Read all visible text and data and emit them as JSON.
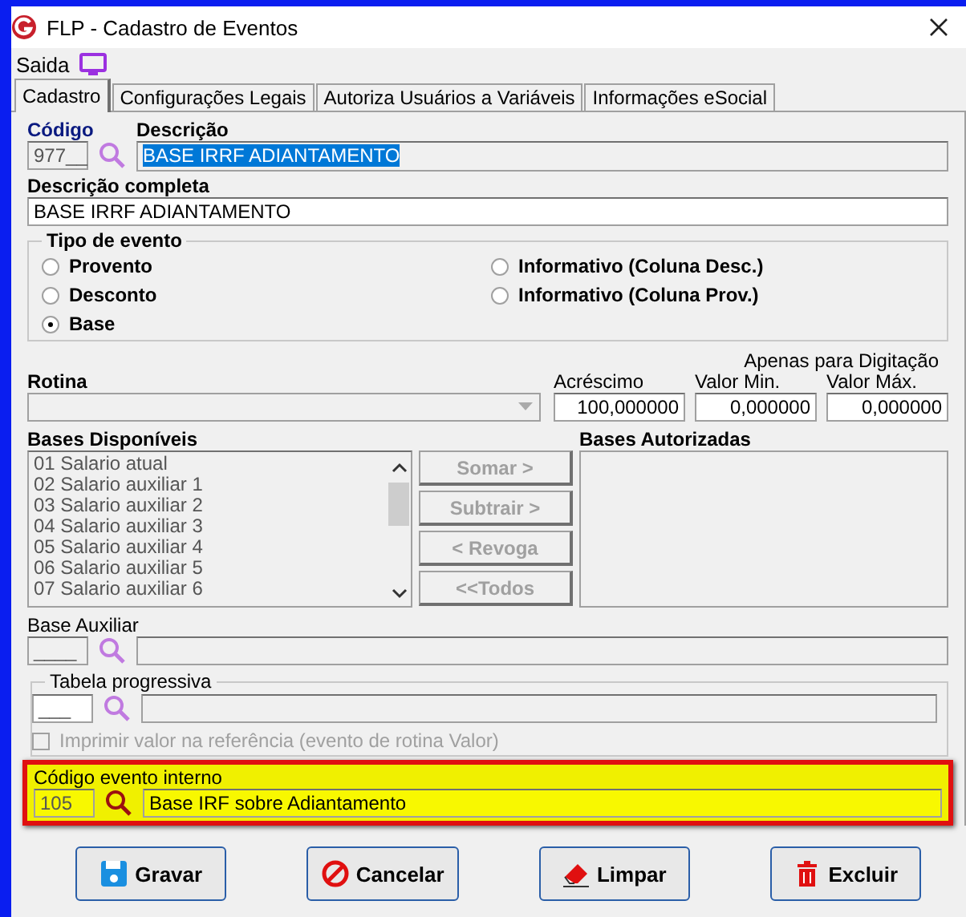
{
  "window": {
    "title": "FLP - Cadastro de Eventos"
  },
  "menu": [
    {
      "label": "Saida"
    }
  ],
  "tabs": [
    {
      "label": "Cadastro",
      "selected": true
    },
    {
      "label": "Configurações Legais",
      "selected": false
    },
    {
      "label": "Autoriza Usuários a Variáveis",
      "selected": false
    },
    {
      "label": "Informações eSocial",
      "selected": false
    }
  ],
  "codigo": {
    "label": "Código",
    "value": "977__"
  },
  "descricao": {
    "label": "Descrição",
    "value": "BASE IRRF ADIANTAMENTO",
    "highlighted": true
  },
  "descricao_completa": {
    "label": "Descrição completa",
    "value": "BASE IRRF ADIANTAMENTO"
  },
  "tipo_de_evento": {
    "title": "Tipo de evento",
    "options": [
      {
        "label": "Provento",
        "selected": false
      },
      {
        "label": "Desconto",
        "selected": false
      },
      {
        "label": "Base",
        "selected": true
      },
      {
        "label": "Informativo (Coluna Desc.)",
        "selected": false
      },
      {
        "label": "Informativo (Coluna Prov.)",
        "selected": false
      }
    ]
  },
  "rotina": {
    "label": "Rotina",
    "disabled": true
  },
  "apenas_para_digitacao": "Apenas para Digitação",
  "acrescimo": {
    "label": "Acréscimo",
    "value": "100,000000"
  },
  "valor_min": {
    "label": "Valor Min.",
    "value": "0,000000"
  },
  "valor_max": {
    "label": "Valor Máx.",
    "value": "0,000000"
  },
  "bases_disponiveis": {
    "label": "Bases Disponíveis",
    "items": [
      "01 Salario atual",
      "02 Salario auxiliar 1",
      "03 Salario auxiliar 2",
      "04 Salario auxiliar 3",
      "05 Salario auxiliar 4",
      "06 Salario auxiliar 5",
      "07 Salario auxiliar 6"
    ]
  },
  "transfer_buttons": [
    {
      "label": "Somar >",
      "disabled": true
    },
    {
      "label": "Subtrair >",
      "disabled": true
    },
    {
      "label": "< Revoga",
      "disabled": true
    },
    {
      "label": "<<Todos",
      "disabled": true
    }
  ],
  "bases_autorizadas": {
    "label": "Bases Autorizadas"
  },
  "base_auxiliar": {
    "label": "Base Auxiliar",
    "value": "____"
  },
  "tabela_progressiva": {
    "title": "Tabela progressiva",
    "value": "___"
  },
  "imprimir_valor": {
    "label": "Imprimir valor na referência (evento de rotina Valor)",
    "checked": false,
    "disabled": true
  },
  "codigo_evento_interno": {
    "label": "Código evento interno",
    "value": "105",
    "description": "Base IRF sobre Adiantamento",
    "highlighted": true
  },
  "buttons": [
    {
      "label": "Gravar",
      "kind": "save"
    },
    {
      "label": "Cancelar",
      "kind": "cancel"
    },
    {
      "label": "Limpar",
      "kind": "clear"
    },
    {
      "label": "Excluir",
      "kind": "delete"
    }
  ]
}
